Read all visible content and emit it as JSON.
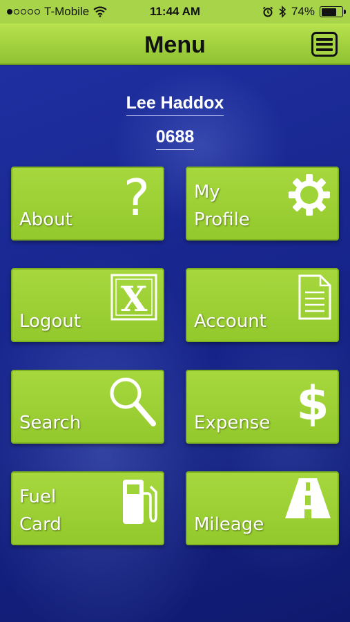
{
  "status_bar": {
    "carrier": "T-Mobile",
    "time": "11:44 AM",
    "battery_percent": "74%",
    "battery_level": 0.74,
    "signal_bars": 1,
    "signal_total": 5
  },
  "nav": {
    "title": "Menu",
    "menu_icon": "hamburger-menu-icon"
  },
  "user": {
    "name": "Lee Haddox",
    "id": "0688"
  },
  "tiles": [
    {
      "label": "About",
      "icon": "question-mark-icon"
    },
    {
      "label": "My\nProfile",
      "icon": "gear-icon"
    },
    {
      "label": "Logout",
      "icon": "x-box-icon"
    },
    {
      "label": "Account",
      "icon": "document-icon"
    },
    {
      "label": "Search",
      "icon": "magnifier-icon"
    },
    {
      "label": "Expense",
      "icon": "dollar-icon"
    },
    {
      "label": "Fuel\nCard",
      "icon": "fuel-pump-icon"
    },
    {
      "label": "Mileage",
      "icon": "road-icon"
    }
  ],
  "colors": {
    "accent_green": "#a6d83e",
    "background_blue": "#1a2a8a"
  }
}
